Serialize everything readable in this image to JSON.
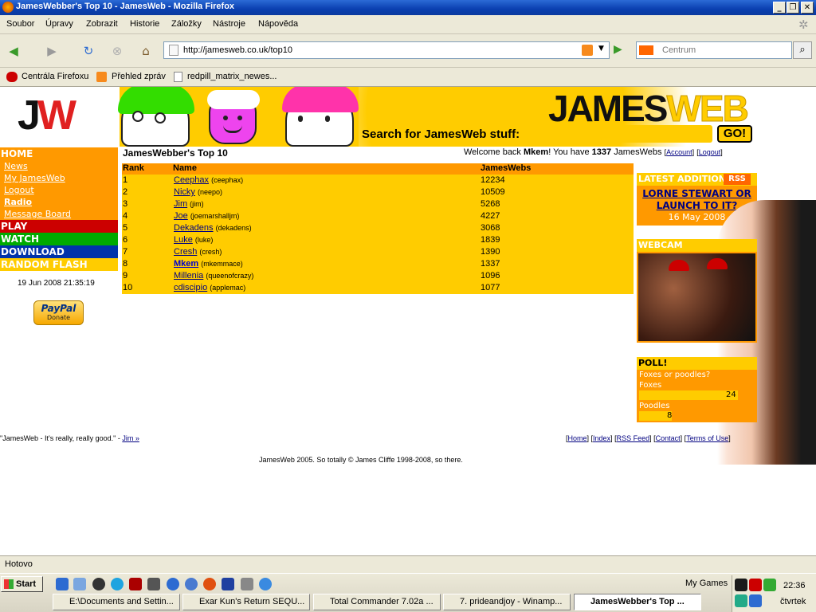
{
  "window": {
    "title": "JamesWebber's Top 10 - JamesWeb - Mozilla Firefox"
  },
  "menu": [
    "Soubor",
    "Úpravy",
    "Zobrazit",
    "Historie",
    "Záložky",
    "Nástroje",
    "Nápověda"
  ],
  "navbar": {
    "url": "http://jamesweb.co.uk/top10",
    "search_placeholder": "Centrum"
  },
  "bookmarks": [
    "Centrála Firefoxu",
    "Přehled zpráv",
    "redpill_matrix_newes..."
  ],
  "banner": {
    "brand": "JAMESWEB",
    "search_label": "Search for JamesWeb stuff:",
    "go": "GO!"
  },
  "leftnav": {
    "home": "HOME",
    "sub": [
      "News",
      "My JamesWeb",
      "Logout",
      "Radio",
      "Message Board"
    ],
    "play": "PLAY",
    "watch": "WATCH",
    "download": "DOWNLOAD",
    "random": "RANDOM FLASH",
    "date": "19 Jun 2008 21:35:19",
    "paypal": "PayPal",
    "donate": "Donate"
  },
  "main": {
    "title": "JamesWebber's Top 10",
    "welcome_prefix": "Welcome back",
    "user": "Mkem",
    "welcome_mid": "! You have",
    "count": "1337",
    "welcome_suffix": "JamesWebs",
    "account": "Account",
    "logout": "Logout",
    "headers": [
      "Rank",
      "Name",
      "JamesWebs"
    ],
    "rows": [
      {
        "rank": "1",
        "name": "Ceephax",
        "user": "(ceephax)",
        "score": "12234"
      },
      {
        "rank": "2",
        "name": "Nicky",
        "user": "(neepo)",
        "score": "10509"
      },
      {
        "rank": "3",
        "name": "Jim",
        "user": "(jim)",
        "score": "5268"
      },
      {
        "rank": "4",
        "name": "Joe",
        "user": "(joemarshalljm)",
        "score": "4227"
      },
      {
        "rank": "5",
        "name": "Dekadens",
        "user": "(dekadens)",
        "score": "3068"
      },
      {
        "rank": "6",
        "name": "Luke",
        "user": "(luke)",
        "score": "1839"
      },
      {
        "rank": "7",
        "name": "Cresh",
        "user": "(cresh)",
        "score": "1390"
      },
      {
        "rank": "8",
        "name": "Mkem",
        "user": "(mkemmace)",
        "score": "1337"
      },
      {
        "rank": "9",
        "name": "Millenia",
        "user": "(queenofcrazy)",
        "score": "1096"
      },
      {
        "rank": "10",
        "name": "cdiscipio",
        "user": "(applemac)",
        "score": "1077"
      }
    ]
  },
  "right": {
    "latest_hdr": "LATEST ADDITION",
    "rss": "RSS",
    "latest_title": "LORNE STEWART OR LAUNCH TO IT?",
    "latest_date": "16 May 2008",
    "webcam_hdr": "WEBCAM",
    "poll_hdr": "POLL!",
    "poll_q": "Foxes or poodles?",
    "poll_a1": "Foxes",
    "poll_v1": "24",
    "poll_a2": "Poodles",
    "poll_v2": "8"
  },
  "footer": {
    "quote": "\"JamesWeb - It's really, really good.\" -",
    "quote_author": "Jim »",
    "links": [
      "Home",
      "Index",
      "RSS Feed",
      "Contact",
      "Terms of Use"
    ],
    "copyright": "JamesWeb 2005. So totally © James Cliffe 1998-2008, so there."
  },
  "status": "Hotovo",
  "taskbar": {
    "start": "Start",
    "mygames": "My Games",
    "clock": "22:36",
    "day": "čtvrtek",
    "tasks": [
      "E:\\Documents and Settin...",
      "Exar Kun's Return SEQU...",
      "Total Commander 7.02a ...",
      "7. prideandjoy - Winamp...",
      "JamesWebber's Top ..."
    ]
  },
  "colors": {
    "orange": "#ff9900",
    "yellow": "#ffcc00",
    "play": "#cc0000",
    "watch": "#00aa00",
    "download": "#0033aa"
  }
}
